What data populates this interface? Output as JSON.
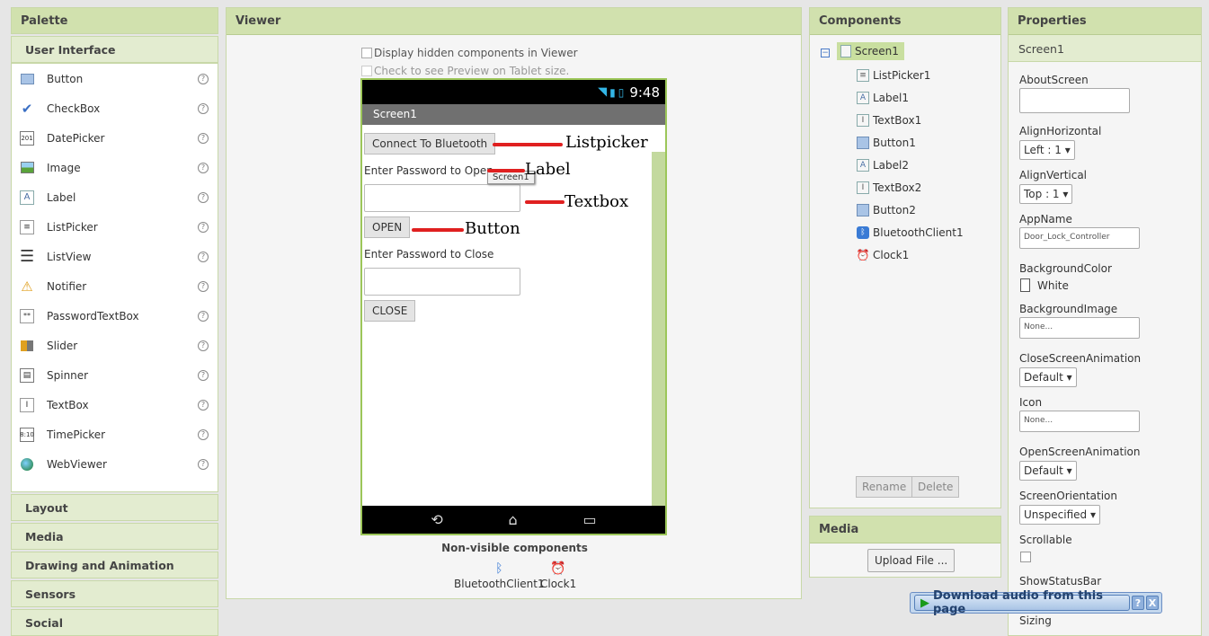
{
  "palette": {
    "title": "Palette",
    "section": "User Interface",
    "items": [
      {
        "label": "Button",
        "icon": "button-icon"
      },
      {
        "label": "CheckBox",
        "icon": "checkbox-icon"
      },
      {
        "label": "DatePicker",
        "icon": "datepicker-icon"
      },
      {
        "label": "Image",
        "icon": "image-icon"
      },
      {
        "label": "Label",
        "icon": "label-icon"
      },
      {
        "label": "ListPicker",
        "icon": "listpicker-icon"
      },
      {
        "label": "ListView",
        "icon": "listview-icon"
      },
      {
        "label": "Notifier",
        "icon": "notifier-icon"
      },
      {
        "label": "PasswordTextBox",
        "icon": "passwordtextbox-icon"
      },
      {
        "label": "Slider",
        "icon": "slider-icon"
      },
      {
        "label": "Spinner",
        "icon": "spinner-icon"
      },
      {
        "label": "TextBox",
        "icon": "textbox-icon"
      },
      {
        "label": "TimePicker",
        "icon": "timepicker-icon"
      },
      {
        "label": "WebViewer",
        "icon": "webviewer-icon"
      }
    ],
    "categories": [
      "Layout",
      "Media",
      "Drawing and Animation",
      "Sensors",
      "Social"
    ]
  },
  "viewer": {
    "title": "Viewer",
    "hidden_components_label": "Display hidden components in Viewer",
    "tablet_preview_label": "Check to see Preview on Tablet size.",
    "phone": {
      "time": "9:48",
      "screen_title": "Screen1",
      "connect_button": "Connect To Bluetooth",
      "label_open": "Enter Password to Open",
      "open_button": "OPEN",
      "label_close": "Enter Password to Close",
      "close_button": "CLOSE",
      "tooltip": "Screen1"
    },
    "annotations": {
      "listpicker": "Listpicker",
      "label": "Label",
      "textbox": "Textbox",
      "button": "Button"
    },
    "nonvisible_title": "Non-visible components",
    "nonvisible": [
      {
        "label": "BluetoothClient1",
        "icon": "bluetooth-icon"
      },
      {
        "label": "Clock1",
        "icon": "clock-icon"
      }
    ]
  },
  "components": {
    "title": "Components",
    "root": "Screen1",
    "items": [
      {
        "label": "ListPicker1",
        "icon": "listpicker-icon"
      },
      {
        "label": "Label1",
        "icon": "label-icon"
      },
      {
        "label": "TextBox1",
        "icon": "textbox-icon"
      },
      {
        "label": "Button1",
        "icon": "button-icon"
      },
      {
        "label": "Label2",
        "icon": "label-icon"
      },
      {
        "label": "TextBox2",
        "icon": "textbox-icon"
      },
      {
        "label": "Button2",
        "icon": "button-icon"
      },
      {
        "label": "BluetoothClient1",
        "icon": "bluetooth-icon"
      },
      {
        "label": "Clock1",
        "icon": "clock-icon"
      }
    ],
    "rename": "Rename",
    "delete": "Delete"
  },
  "media": {
    "title": "Media",
    "upload": "Upload File ..."
  },
  "properties": {
    "title": "Properties",
    "component": "Screen1",
    "about_screen": "AboutScreen",
    "align_horizontal": "AlignHorizontal",
    "align_horizontal_value": "Left : 1 ▾",
    "align_vertical": "AlignVertical",
    "align_vertical_value": "Top : 1 ▾",
    "app_name": "AppName",
    "app_name_value": "Door_Lock_Controller",
    "background_color": "BackgroundColor",
    "background_color_value": "White",
    "background_image": "BackgroundImage",
    "background_image_value": "None...",
    "close_anim": "CloseScreenAnimation",
    "close_anim_value": "Default ▾",
    "icon": "Icon",
    "icon_value": "None...",
    "open_anim": "OpenScreenAnimation",
    "open_anim_value": "Default ▾",
    "orientation": "ScreenOrientation",
    "orientation_value": "Unspecified ▾",
    "scrollable": "Scrollable",
    "show_status_bar": "ShowStatusBar",
    "sizing": "Sizing"
  },
  "download_bar": {
    "label": "Download audio from this page",
    "help": "?",
    "close": "X"
  }
}
